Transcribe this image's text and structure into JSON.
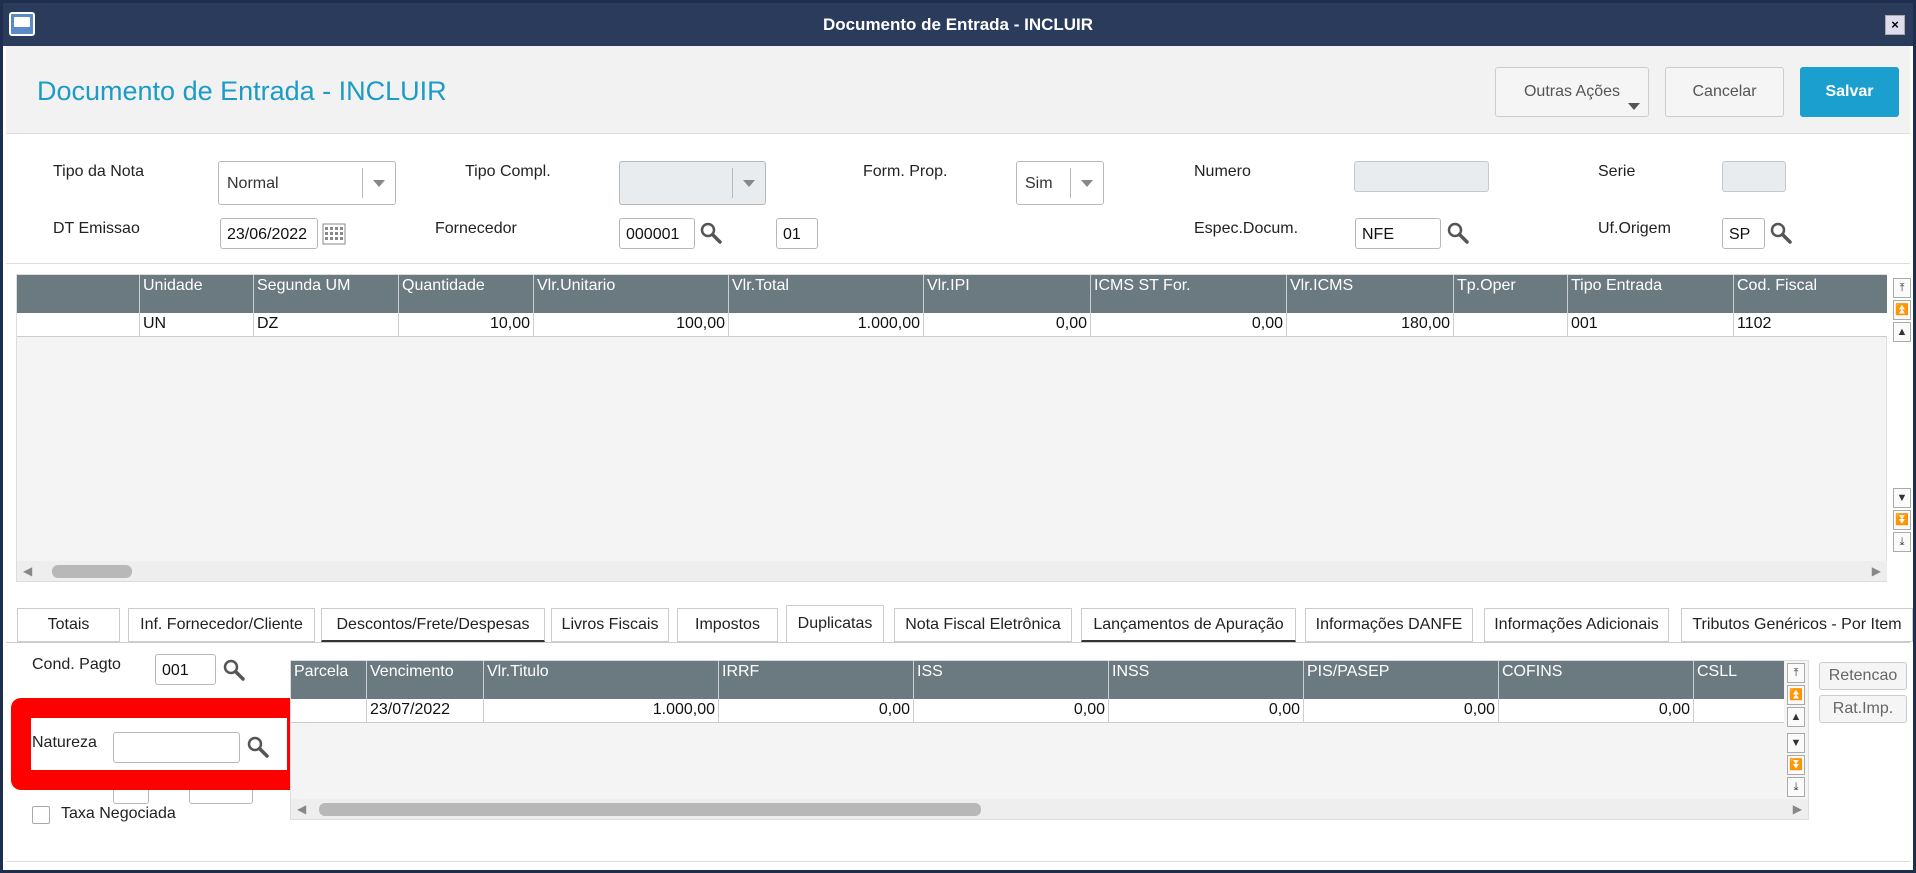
{
  "window": {
    "title": "Documento de Entrada - INCLUIR",
    "close_label": "×"
  },
  "header": {
    "title": "Documento de Entrada - INCLUIR",
    "buttons": {
      "more_actions": "Outras Ações",
      "cancel": "Cancelar",
      "save": "Salvar"
    }
  },
  "form": {
    "tipo_nota": {
      "label": "Tipo da Nota",
      "value": "Normal"
    },
    "tipo_compl": {
      "label": "Tipo Compl.",
      "value": ""
    },
    "form_prop": {
      "label": "Form. Prop.",
      "value": "Sim"
    },
    "numero": {
      "label": "Numero",
      "value": ""
    },
    "serie": {
      "label": "Serie",
      "value": ""
    },
    "dt_emissao": {
      "label": "DT Emissao",
      "value": "23/06/2022"
    },
    "fornecedor": {
      "label": "Fornecedor",
      "code": "000001",
      "loja": "01"
    },
    "espec_docum": {
      "label": "Espec.Docum.",
      "value": "NFE"
    },
    "uf_origem": {
      "label": "Uf.Origem",
      "value": "SP"
    }
  },
  "items_grid": {
    "columns": [
      "",
      "Unidade",
      "Segunda UM",
      "Quantidade",
      "Vlr.Unitario",
      "Vlr.Total",
      "Vlr.IPI",
      "ICMS ST For.",
      "Vlr.ICMS",
      "Tp.Oper",
      "Tipo Entrada",
      "Cod. Fiscal"
    ],
    "rows": [
      [
        "",
        "UN",
        "DZ",
        "10,00",
        "100,00",
        "1.000,00",
        "0,00",
        "0,00",
        "180,00",
        "",
        "001",
        "1102"
      ]
    ]
  },
  "tabs": [
    "Totais",
    "Inf. Fornecedor/Cliente",
    "Descontos/Frete/Despesas",
    "Livros Fiscais",
    "Impostos",
    "Duplicatas",
    "Nota Fiscal Eletrônica",
    "Lançamentos de Apuração",
    "Informações DANFE",
    "Informações Adicionais",
    "Tributos Genéricos - Por Item"
  ],
  "active_tab": "Duplicatas",
  "duplicatas": {
    "cond_pagto": {
      "label": "Cond. Pagto",
      "value": "001"
    },
    "natureza": {
      "label": "Natureza",
      "value": ""
    },
    "taxa_negociada": {
      "label": "Taxa Negociada",
      "checked": false
    },
    "side_buttons": {
      "retencao": "Retencao",
      "rat_imp": "Rat.Imp."
    },
    "grid": {
      "columns": [
        "Parcela",
        "Vencimento",
        "Vlr.Titulo",
        "IRRF",
        "ISS",
        "INSS",
        "PIS/PASEP",
        "COFINS",
        "CSLL"
      ],
      "rows": [
        [
          "",
          "23/07/2022",
          "1.000,00",
          "0,00",
          "0,00",
          "0,00",
          "0,00",
          "0,00",
          ""
        ]
      ]
    }
  },
  "colors": {
    "title_blue": "#1c9bc6",
    "save_blue": "#1a9fcf",
    "grid_header": "#6b7a80",
    "highlight": "#ff0000"
  }
}
